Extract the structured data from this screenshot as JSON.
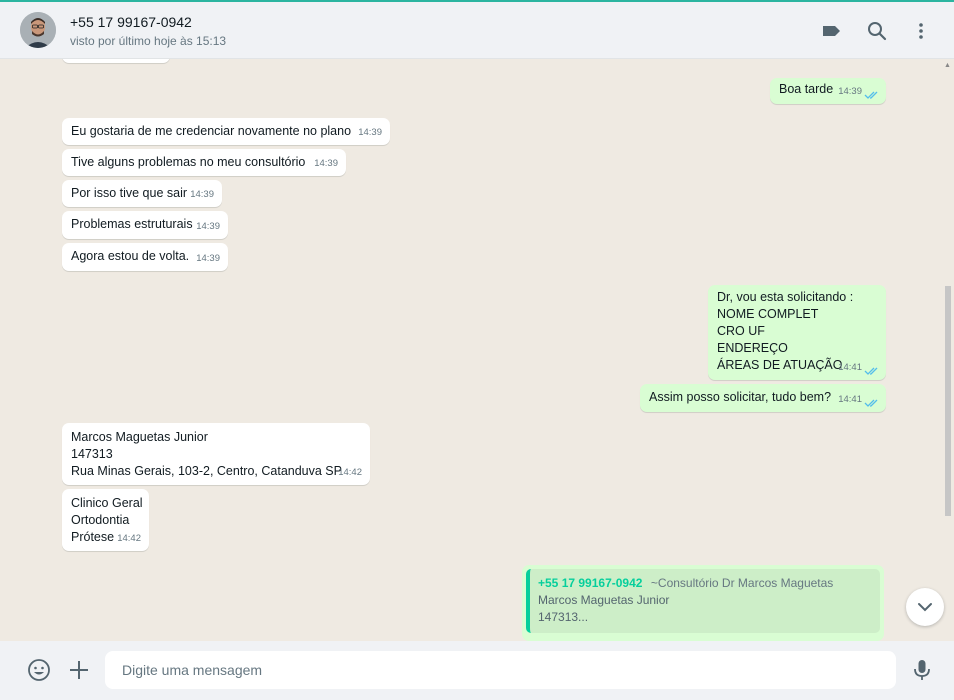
{
  "header": {
    "contact_name": "+55 17 99167-0942",
    "contact_status": "visto por último hoje às 15:13",
    "icons": [
      "label-icon",
      "search-icon",
      "menu-icon"
    ]
  },
  "messages": [
    {
      "dir": "out",
      "text": [
        "Boa tarde"
      ],
      "time": "14:39"
    },
    {
      "dir": "in",
      "text": [
        "Eu gostaria de me credenciar novamente no plano"
      ],
      "time": "14:39"
    },
    {
      "dir": "in",
      "text": [
        "Tive alguns problemas no meu consultório"
      ],
      "time": "14:39"
    },
    {
      "dir": "in",
      "text": [
        "Por isso tive que sair"
      ],
      "time": "14:39"
    },
    {
      "dir": "in",
      "text": [
        "Problemas estruturais"
      ],
      "time": "14:39"
    },
    {
      "dir": "in",
      "text": [
        "Agora estou de volta."
      ],
      "time": "14:39"
    },
    {
      "dir": "out",
      "text": [
        "Dr, vou esta solicitando :",
        "NOME COMPLET",
        "CRO UF",
        "ENDEREÇO",
        "ÁREAS DE ATUAÇÃO"
      ],
      "time": "14:41"
    },
    {
      "dir": "out",
      "text": [
        "Assim posso solicitar, tudo bem?"
      ],
      "time": "14:41"
    },
    {
      "dir": "in",
      "text": [
        "Marcos Maguetas Junior",
        "147313",
        "Rua Minas Gerais, 103-2, Centro, Catanduva SP"
      ],
      "time": "14:42"
    },
    {
      "dir": "in",
      "text": [
        "Clinico Geral",
        "Ortodontia",
        "Prótese"
      ],
      "time": "14:42"
    }
  ],
  "quoted": {
    "author": "+55 17 99167-0942",
    "pushname": "~Consultório Dr Marcos Maguetas",
    "line1": "Marcos Maguetas Junior",
    "line2": "147313..."
  },
  "footer": {
    "placeholder": "Digite uma mensagem",
    "icons": [
      "emoji-icon",
      "attach-plus-icon",
      "microphone-icon"
    ]
  },
  "colors": {
    "accent": "#06cf9c",
    "outgoing_bubble": "#d9fdd3",
    "incoming_bubble": "#ffffff",
    "chat_background": "#efeae2",
    "read_ticks": "#53bdeb"
  }
}
